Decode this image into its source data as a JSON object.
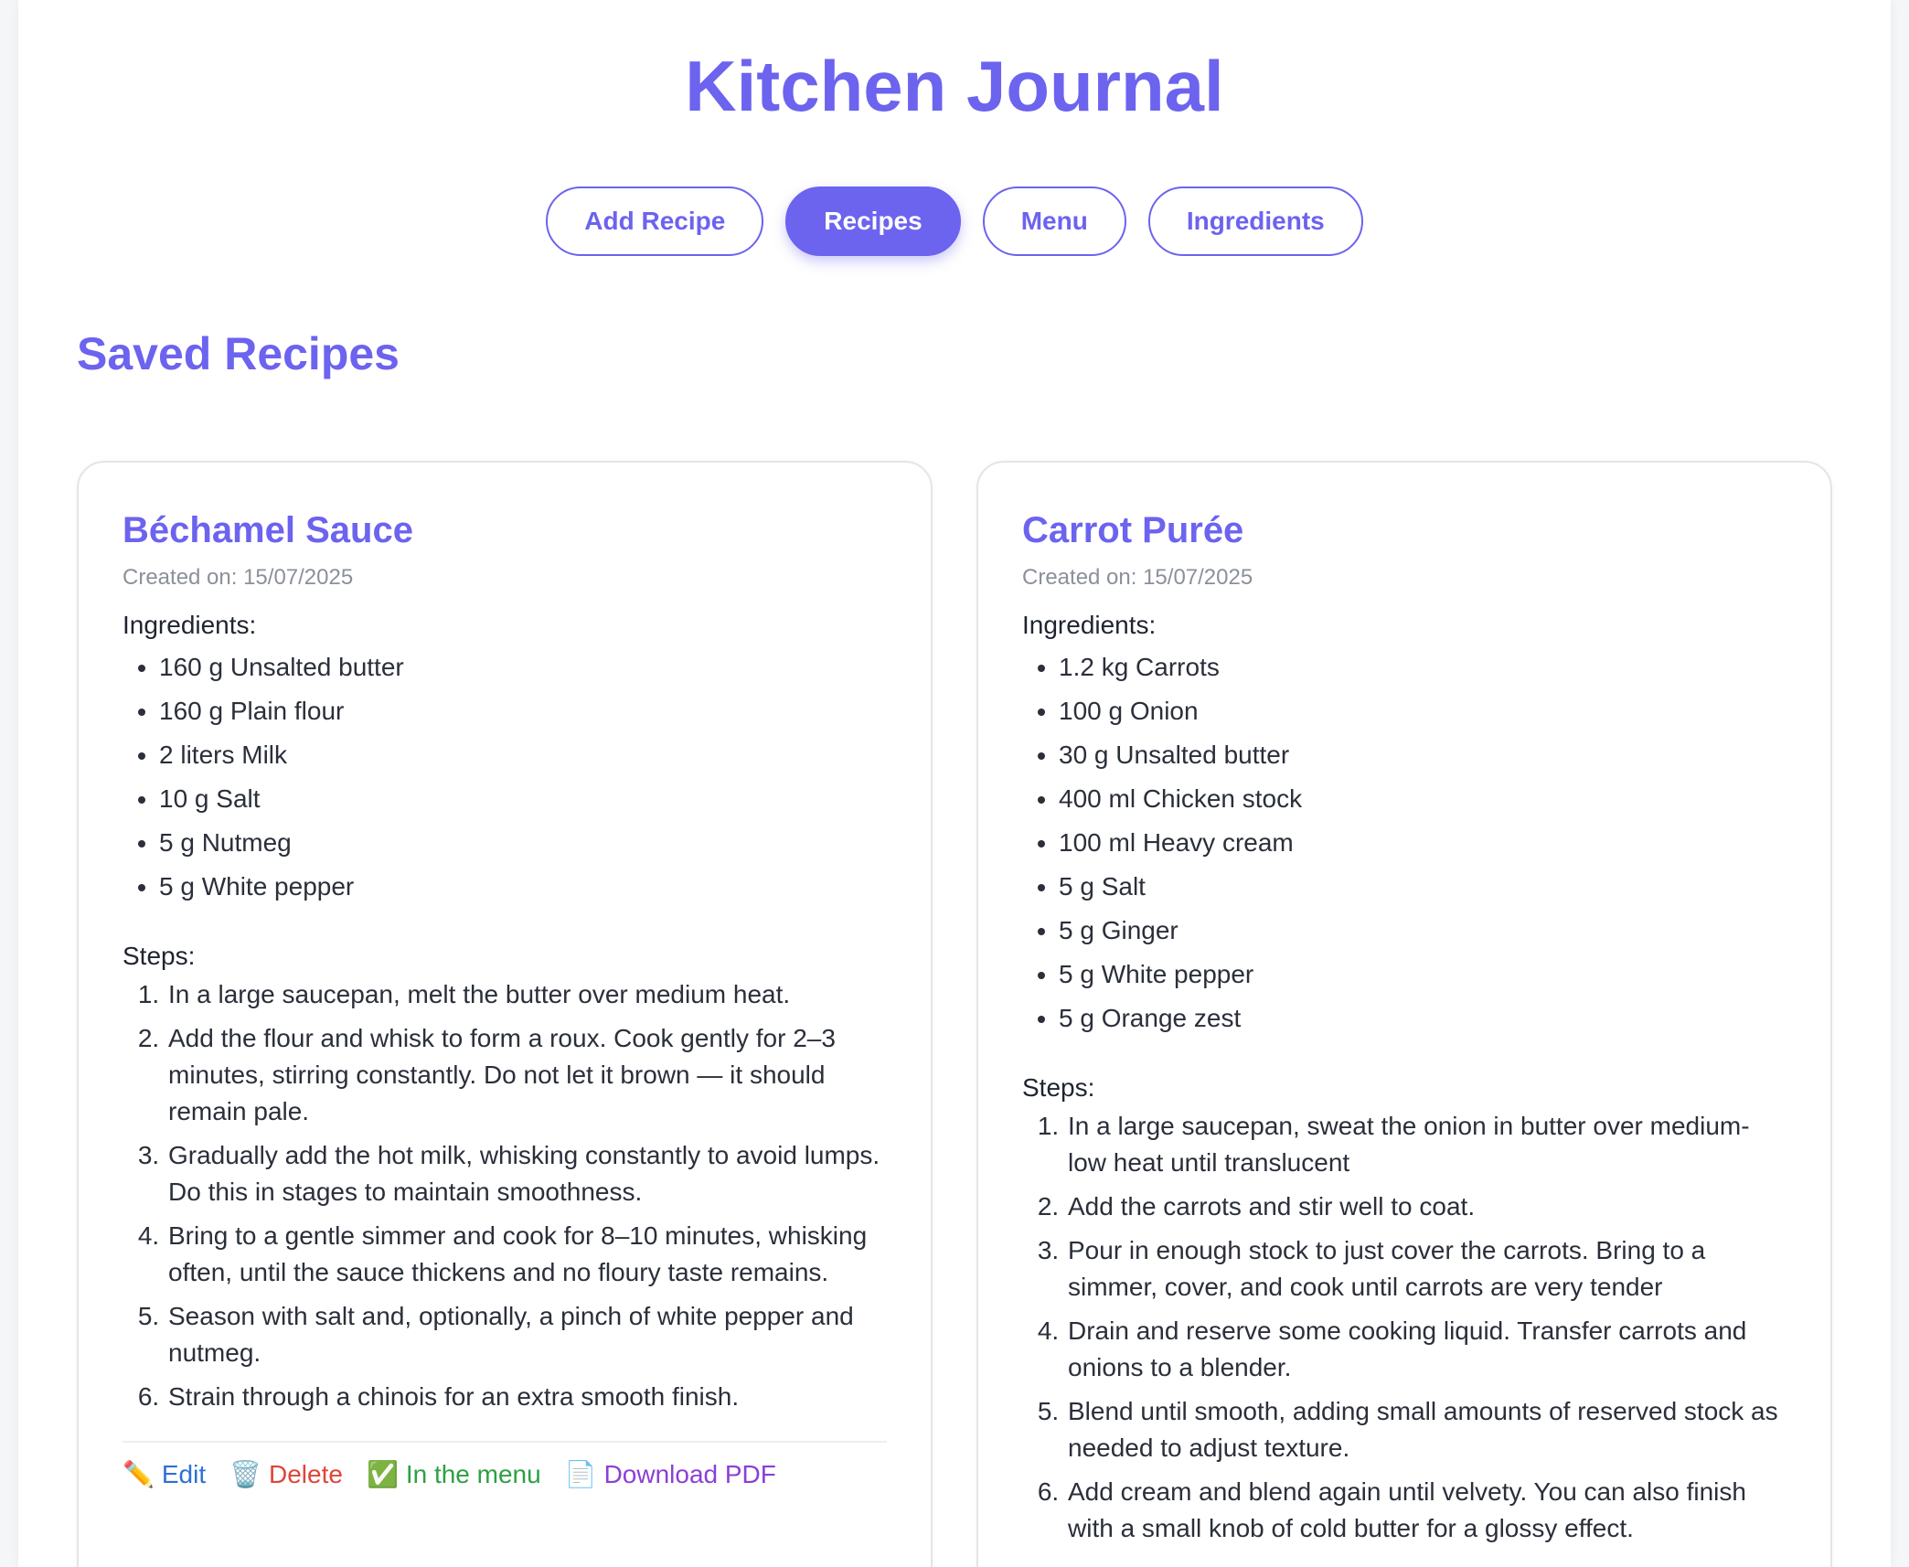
{
  "app": {
    "title": "Kitchen Journal"
  },
  "nav": {
    "items": [
      {
        "label": "Add Recipe",
        "active": false
      },
      {
        "label": "Recipes",
        "active": true
      },
      {
        "label": "Menu",
        "active": false
      },
      {
        "label": "Ingredients",
        "active": false
      }
    ]
  },
  "section": {
    "title": "Saved Recipes"
  },
  "colors": {
    "accent": "#6c63ef",
    "edit": "#2f6fd8",
    "delete": "#e0443a",
    "menu": "#2ea043",
    "pdf": "#8a3fd6"
  },
  "labels": {
    "ingredients": "Ingredients:",
    "steps": "Steps:"
  },
  "recipes": [
    {
      "title": "Béchamel Sauce",
      "created": "Created on: 15/07/2025",
      "ingredients": [
        "160 g Unsalted butter",
        "160 g Plain flour",
        "2 liters Milk",
        "10 g Salt",
        "5 g Nutmeg",
        "5 g White pepper"
      ],
      "steps": [
        "In a large saucepan, melt the butter over medium heat.",
        "Add the flour and whisk to form a roux. Cook gently for 2–3 minutes, stirring constantly. Do not let it brown — it should remain pale.",
        "Gradually add the hot milk, whisking constantly to avoid lumps. Do this in stages to maintain smoothness.",
        "Bring to a gentle simmer and cook for 8–10 minutes, whisking often, until the sauce thickens and no floury taste remains.",
        "Season with salt and, optionally, a pinch of white pepper and nutmeg.",
        "Strain through a chinois for an extra smooth finish."
      ],
      "actions": {
        "edit": {
          "icon": "✏️",
          "icon_name": "pencil-icon",
          "label": "Edit"
        },
        "delete": {
          "icon": "🗑️",
          "icon_name": "trash-icon",
          "label": "Delete"
        },
        "menu": {
          "icon": "✅",
          "icon_name": "check-icon",
          "label": "In the menu"
        },
        "pdf": {
          "icon": "📄",
          "icon_name": "document-icon",
          "label": "Download PDF"
        }
      }
    },
    {
      "title": "Carrot Purée",
      "created": "Created on: 15/07/2025",
      "ingredients": [
        "1.2 kg Carrots",
        "100 g Onion",
        "30 g Unsalted butter",
        "400 ml Chicken stock",
        "100 ml Heavy cream",
        "5 g Salt",
        "5 g Ginger",
        "5 g White pepper",
        "5 g Orange zest"
      ],
      "steps": [
        "In a large saucepan, sweat the onion in butter over medium-low heat until translucent",
        "Add the carrots and stir well to coat.",
        "Pour in enough stock to just cover the carrots. Bring to a simmer, cover, and cook until carrots are very tender",
        "Drain and reserve some cooking liquid. Transfer carrots and onions to a blender.",
        "Blend until smooth, adding small amounts of reserved stock as needed to adjust texture.",
        "Add cream and blend again until velvety. You can also finish with a small knob of cold butter for a glossy effect."
      ]
    }
  ]
}
